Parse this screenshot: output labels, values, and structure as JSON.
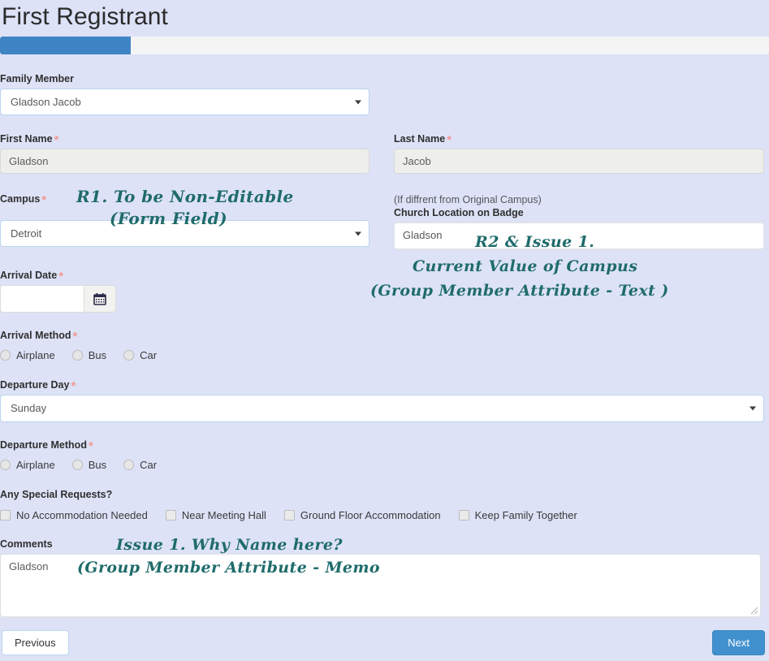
{
  "page": {
    "title": "First Registrant",
    "background_color": "#dde2f7",
    "accent_color": "#3f85c6",
    "required_marker_color": "#f09a93",
    "annotation_color": "#1f6b6b"
  },
  "progress": {
    "percent": 17,
    "fill_color": "#3f85c6",
    "track_color": "#f4f4f4"
  },
  "form": {
    "family_member": {
      "label": "Family Member",
      "value": "Gladson Jacob",
      "required": false
    },
    "first_name": {
      "label": "First Name",
      "value": "Gladson",
      "required_marker": "*",
      "editable": false
    },
    "last_name": {
      "label": "Last Name",
      "value": "Jacob",
      "required_marker": "*",
      "editable": false
    },
    "campus": {
      "label": "Campus",
      "value": "Detroit",
      "required_marker": "*"
    },
    "church_location": {
      "sublabel": "(If diffrent from Original Campus)",
      "label": "Church Location on Badge",
      "value": "Gladson"
    },
    "arrival_date": {
      "label": "Arrival Date",
      "value": "",
      "required_marker": "*",
      "calendar_icon": "calendar-icon"
    },
    "arrival_method": {
      "label": "Arrival Method",
      "required_marker": "*",
      "options": [
        "Airplane",
        "Bus",
        "Car"
      ],
      "selected": null
    },
    "departure_day": {
      "label": "Departure Day",
      "value": "Sunday",
      "required_marker": "*"
    },
    "departure_method": {
      "label": "Departure Method",
      "required_marker": "*",
      "options": [
        "Airplane",
        "Bus",
        "Car"
      ],
      "selected": null
    },
    "special_requests": {
      "label": "Any Special Requests?",
      "options": [
        "No Accommodation Needed",
        "Near Meeting Hall",
        "Ground Floor Accommodation",
        "Keep Family Together"
      ],
      "checked": []
    },
    "comments": {
      "label": "Comments",
      "value": "Gladson"
    }
  },
  "footer": {
    "previous_label": "Previous",
    "next_label": "Next"
  },
  "annotations": {
    "campus_line1": "R1.  To be Non-Editable",
    "campus_line2": "(Form Field)",
    "badge_line1": "R2 & Issue 1.",
    "badge_line2": "Current Value of Campus",
    "badge_line3": "(Group Member Attribute - Text )",
    "comments_line1": "Issue 1. Why Name here?",
    "comments_line2": "(Group Member Attribute - Memo"
  }
}
